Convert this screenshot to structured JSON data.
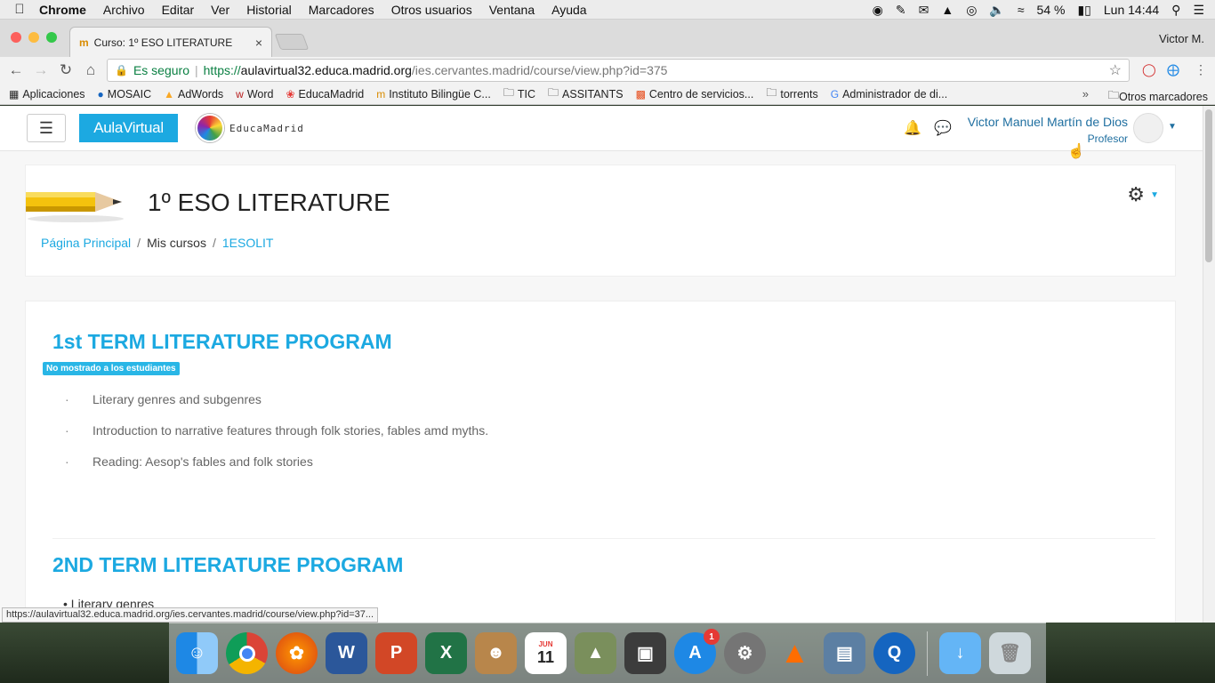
{
  "menubar": {
    "items": [
      "Chrome",
      "Archivo",
      "Editar",
      "Ver",
      "Historial",
      "Marcadores",
      "Otros usuarios",
      "Ventana",
      "Ayuda"
    ],
    "battery": "54 %",
    "clock": "Lun 14:44"
  },
  "browser": {
    "tab_title": "Curso: 1º ESO LITERATURE",
    "profile_name": "Victor M.",
    "security_label": "Es seguro",
    "url_scheme": "https://",
    "url_host": "aulavirtual32.educa.madrid.org",
    "url_path": "/ies.cervantes.madrid/course/view.php?id=375",
    "status_url": "https://aulavirtual32.educa.madrid.org/ies.cervantes.madrid/course/view.php?id=37..."
  },
  "bookmarks": {
    "items": [
      "Aplicaciones",
      "MOSAIC",
      "AdWords",
      "Word",
      "EducaMadrid",
      "Instituto Bilingüe C...",
      "TIC",
      "ASSITANTS",
      "Centro de servicios...",
      "torrents",
      "Administrador de di..."
    ],
    "more": "»",
    "other": "Otros marcadores"
  },
  "navbar": {
    "brand": "AulaVirtual",
    "logo_text": "EducaMadrid",
    "user_name": "Victor Manuel Martín de Dios",
    "user_role": "Profesor"
  },
  "course": {
    "title": "1º ESO LITERATURE",
    "breadcrumb": [
      "Página Principal",
      "Mis cursos",
      "1ESOLIT"
    ]
  },
  "sections": [
    {
      "title": "1st TERM LITERATURE PROGRAM",
      "badge": "No mostrado a los estudiantes",
      "items": [
        "Literary genres and subgenres",
        "Introduction to narrative features through folk stories, fables amd myths.",
        "Reading: Aesop's fables and folk stories"
      ]
    },
    {
      "title": "2ND TERM LITERATURE PROGRAM",
      "items": [
        "Literary genres"
      ]
    }
  ],
  "dock": {
    "calendar_month": "JUN",
    "calendar_day": "11",
    "appstore_badge": "1"
  },
  "colors": {
    "accent": "#1ca9e1",
    "link_user": "#1f6fa0",
    "secure_green": "#0b8043"
  }
}
